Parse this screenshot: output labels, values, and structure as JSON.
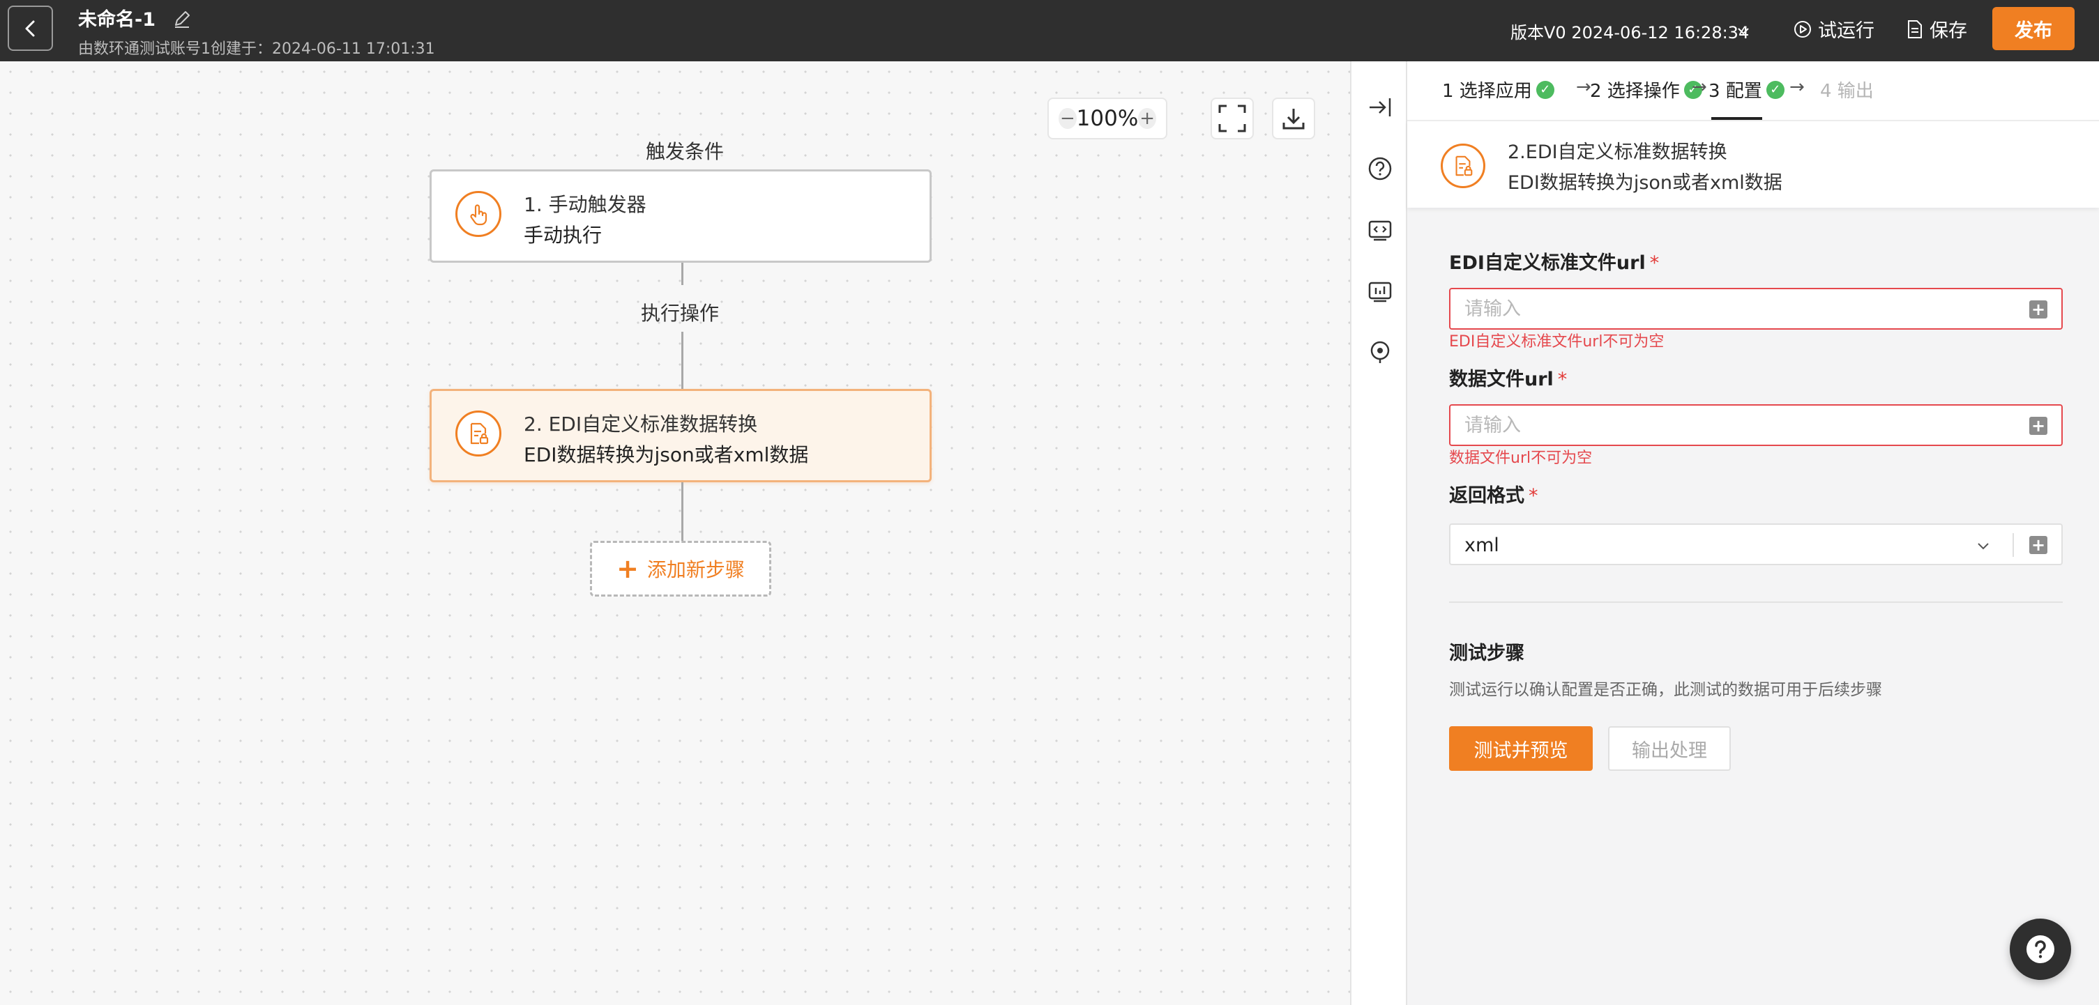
{
  "header": {
    "title": "未命名-1",
    "subtitle": "由数环通测试账号1创建于：2024-06-11 17:01:31",
    "version": "版本V0 2024-06-12 16:28:34",
    "trial_run": "试运行",
    "save": "保存",
    "publish": "发布",
    "colors": {
      "bar": "#2f2f2f",
      "accent": "#f07f22"
    }
  },
  "canvas": {
    "zoom": "100%",
    "trigger_label": "触发条件",
    "action_label": "执行操作",
    "nodes": [
      {
        "title": "1. 手动触发器",
        "desc": "手动执行",
        "icon": "hand-pointer-icon"
      },
      {
        "title": "2. EDI自定义标准数据转换",
        "desc": "EDI数据转换为json或者xml数据",
        "icon": "document-lock-icon"
      }
    ],
    "add_step": "添加新步骤"
  },
  "steps": [
    {
      "label": "1 选择应用",
      "done": true
    },
    {
      "label": "2 选择操作",
      "done": true
    },
    {
      "label": "3 配置",
      "done": true
    },
    {
      "label": "4 输出",
      "done": false
    }
  ],
  "panel": {
    "info_title": "2.EDI自定义标准数据转换",
    "info_desc": "EDI数据转换为json或者xml数据",
    "fields": [
      {
        "label": "EDI自定义标准文件url",
        "required": "*",
        "placeholder": "请输入",
        "error": "EDI自定义标准文件url不可为空"
      },
      {
        "label": "数据文件url",
        "required": "*",
        "placeholder": "请输入",
        "error": "数据文件url不可为空"
      },
      {
        "label": "返回格式",
        "required": "*",
        "value": "xml"
      }
    ],
    "test_title": "测试步骤",
    "test_desc": "测试运行以确认配置是否正确，此测试的数据可用于后续步骤",
    "test_button": "测试并预览",
    "output_button": "输出处理"
  }
}
